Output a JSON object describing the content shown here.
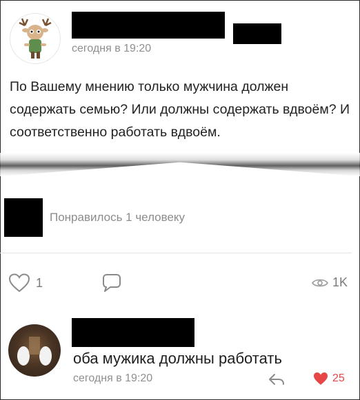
{
  "post": {
    "time": "сегодня в 19:20",
    "text": "По Вашему мнению только мужчина должен содержать семью? Или должны содержать вдвоём? И соответственно работать вдвоём."
  },
  "likes_summary": {
    "text": "Понравилось 1 человеку"
  },
  "actions": {
    "like_count": "1",
    "views_count": "1K",
    "icons": {
      "like": "heart-outline-icon",
      "comment": "comment-icon",
      "views": "eye-icon"
    }
  },
  "comment": {
    "text": "оба мужика должны работать",
    "time": "сегодня в 19:20",
    "like_count": "25",
    "icons": {
      "reply": "reply-arrow-icon",
      "like": "heart-filled-icon"
    }
  },
  "colors": {
    "muted_text": "#8f8f8f",
    "like_red": "#e64646",
    "redaction": "#000000"
  }
}
